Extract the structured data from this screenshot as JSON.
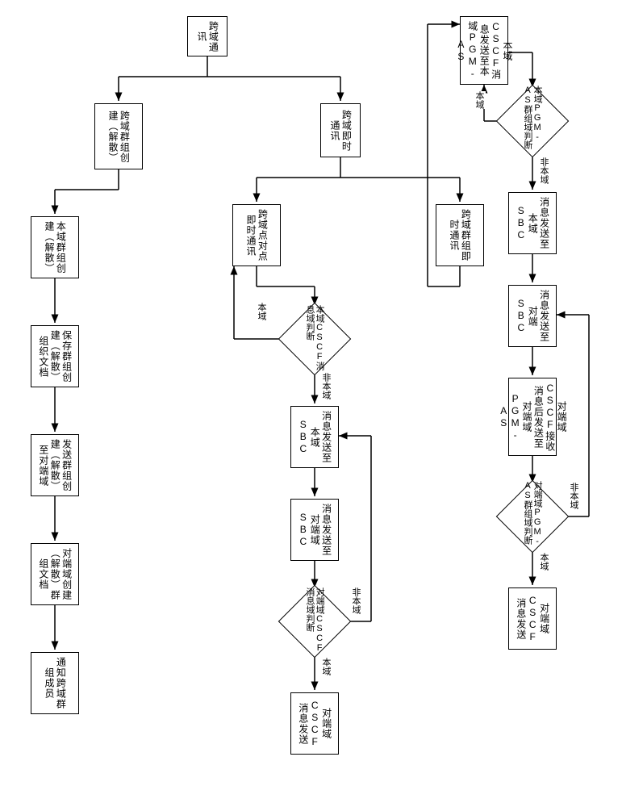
{
  "diagram": {
    "title": "跨域通讯",
    "root": "跨域通讯",
    "branches": {
      "group_create": {
        "label": "跨域群组创建（解散）",
        "steps": [
          "本域群组创建（解散）",
          "保存群组创建（解散）组织文档",
          "发送群组创建（解散）至对端域",
          "对端域创建（解散）群组文档",
          "通知跨域群组成员"
        ]
      },
      "im": {
        "label": "跨域即时通讯",
        "p2p": {
          "label": "跨域点对点即时通讯",
          "decision1": {
            "text": "本域CSCF消息域判断",
            "local": "本域",
            "nonlocal": "非本域"
          },
          "steps_nonlocal": [
            "消息发送至本域SBC",
            "消息发送至对端域SBC"
          ],
          "decision2": {
            "text": "对端域CSCF消息域判断",
            "local": "本域",
            "nonlocal": "非本域"
          },
          "final": "对端域CSCF消息发送"
        },
        "group": {
          "label": "跨域群组即时通讯",
          "step1": "本域CSCF消息发送至本域PGM-AS",
          "decision1": {
            "text": "本域PGM-AS群组域判断",
            "local": "本域",
            "nonlocal": "非本域"
          },
          "steps_nonlocal": [
            "消息发送至本域SBC",
            "消息发送至对端SBC",
            "对端域CSCF接收消息后发送至对端域PGM-AS"
          ],
          "decision2": {
            "text": "对端域PGM-AS群组域判断",
            "local": "本域",
            "nonlocal": "非本域"
          },
          "final": "对端域CSCF消息发送"
        }
      }
    }
  }
}
